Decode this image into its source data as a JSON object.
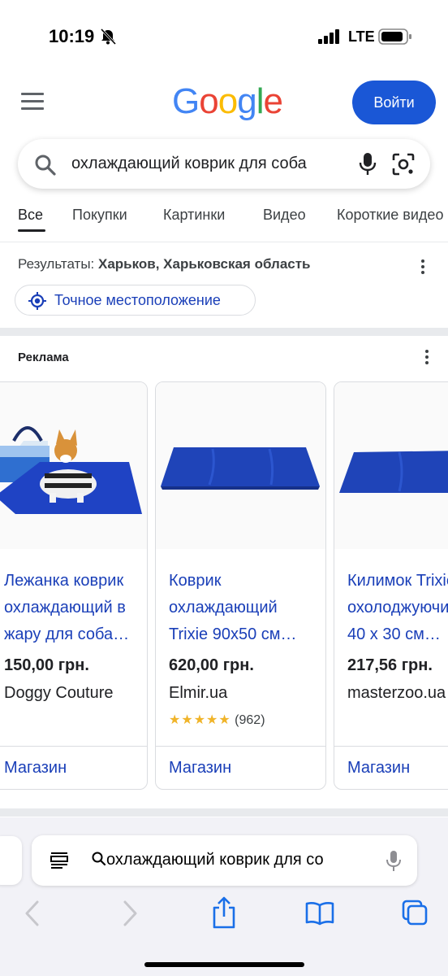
{
  "status_bar": {
    "time": "10:19",
    "network": "LTE",
    "icons": [
      "bell-slash-icon",
      "signal-icon",
      "battery-icon"
    ]
  },
  "header": {
    "logo": "Google",
    "logo_colors": [
      "#4285F4",
      "#EA4335",
      "#FBBC05",
      "#4285F4",
      "#34A853",
      "#EA4335"
    ],
    "signin_label": "Войти",
    "accent": "#1a57d6"
  },
  "search": {
    "query": "охлаждающий коврик для соба",
    "icons": [
      "search-icon",
      "mic-icon",
      "camera-lens-icon"
    ]
  },
  "tabs": [
    {
      "label": "Все",
      "active": true
    },
    {
      "label": "Покупки",
      "active": false
    },
    {
      "label": "Картинки",
      "active": false
    },
    {
      "label": "Видео",
      "active": false
    },
    {
      "label": "Короткие видео",
      "active": false
    }
  ],
  "location": {
    "prefix": "Результаты: ",
    "place": "Харьков, Харьковская область",
    "precise_label": "Точное местоположение"
  },
  "ads": {
    "label": "Реклама",
    "products": [
      {
        "title_line1": "Лежанка коврик",
        "title_line2": "охлаждающий в",
        "title_line3": "жару для соба…",
        "price": "150,00 грн.",
        "seller": "Doggy Couture",
        "rating": "",
        "reviews": "",
        "shop_label": "Магазин"
      },
      {
        "title_line1": "Коврик",
        "title_line2": "охлаждающий",
        "title_line3": "Trixie 90x50 см…",
        "price": "620,00 грн.",
        "seller": "Elmir.ua",
        "rating": "★★★★★",
        "reviews": "(962)",
        "shop_label": "Магазин"
      },
      {
        "title_line1": "Килимок Trixie",
        "title_line2": "охолоджуючий",
        "title_line3": "40 x 30 см…",
        "price": "217,56 грн.",
        "seller": "masterzoo.ua",
        "rating": "",
        "reviews": "",
        "shop_label": "Магазин"
      }
    ]
  },
  "browser": {
    "address_query": "охлаждающий коврик для со",
    "nav_icons": [
      "back-icon",
      "forward-icon",
      "share-icon",
      "bookmarks-icon",
      "tabs-icon"
    ]
  }
}
